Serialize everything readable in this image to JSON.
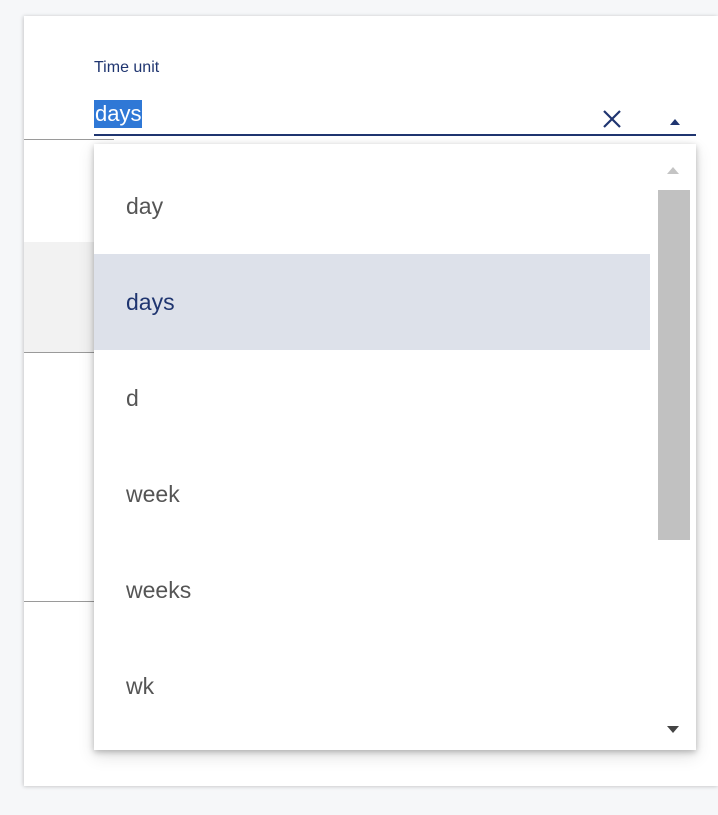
{
  "time_unit_field": {
    "label": "Time unit",
    "value": "days",
    "clear_icon": "close-icon",
    "toggle_icon": "caret-up-icon",
    "accent_color": "#1f3570",
    "selection_color": "#2f78d6"
  },
  "dropdown": {
    "options": [
      {
        "label": "day",
        "selected": false
      },
      {
        "label": "days",
        "selected": true
      },
      {
        "label": "d",
        "selected": false
      },
      {
        "label": "week",
        "selected": false
      },
      {
        "label": "weeks",
        "selected": false
      },
      {
        "label": "wk",
        "selected": false
      }
    ],
    "selected_background": "#dde1ea",
    "scrollbar": {
      "up_icon": "scroll-up-arrow-icon",
      "down_icon": "scroll-down-arrow-icon"
    }
  }
}
